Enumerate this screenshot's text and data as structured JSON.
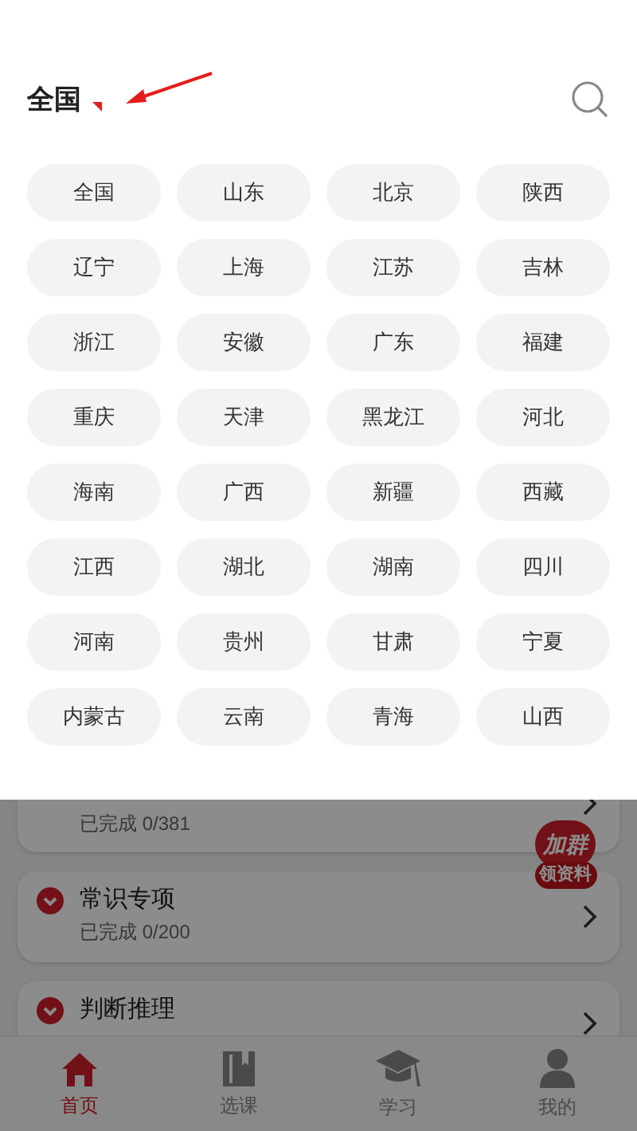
{
  "header": {
    "title": "全国"
  },
  "provinces": [
    "全国",
    "山东",
    "北京",
    "陕西",
    "辽宁",
    "上海",
    "江苏",
    "吉林",
    "浙江",
    "安徽",
    "广东",
    "福建",
    "重庆",
    "天津",
    "黑龙江",
    "河北",
    "海南",
    "广西",
    "新疆",
    "西藏",
    "江西",
    "湖北",
    "湖南",
    "四川",
    "河南",
    "贵州",
    "甘肃",
    "宁夏",
    "内蒙古",
    "云南",
    "青海",
    "山西"
  ],
  "course_list": [
    {
      "progress": "已完成 0/381"
    },
    {
      "title": "常识专项",
      "progress": "已完成 0/200"
    },
    {
      "title": "判断推理"
    }
  ],
  "promo_badge": {
    "line_1": "加群",
    "line_2": "领资料"
  },
  "tab_bar": [
    {
      "kind": "home",
      "label": "首页",
      "selected": true
    },
    {
      "kind": "book",
      "label": "选课",
      "selected": false
    },
    {
      "kind": "cap",
      "label": "学习",
      "selected": false
    },
    {
      "kind": "person",
      "label": "我的",
      "selected": false
    }
  ]
}
